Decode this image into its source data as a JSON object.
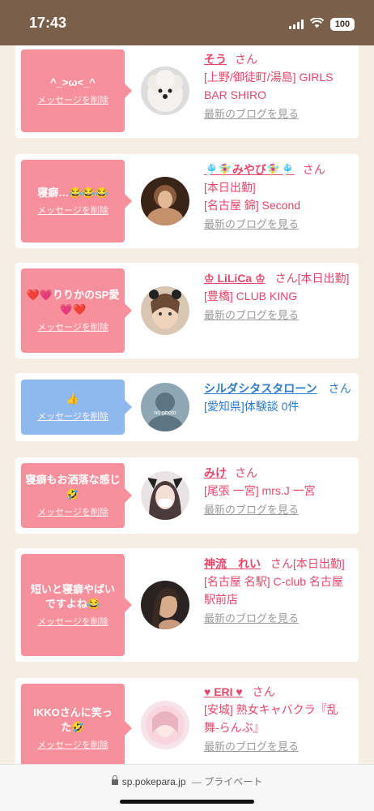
{
  "status": {
    "time": "17:43",
    "battery": "100"
  },
  "colors": {
    "status_bar": "#7a5f4a",
    "page_bg": "#f7eee3",
    "pink_bubble": "#f7909c",
    "blue_bubble": "#8db9ee",
    "name_pink": "#e5486a",
    "name_blue": "#2e7bc9",
    "blog_link": "#9a9a9a"
  },
  "common": {
    "delete_label": "メッセージを削除",
    "honorific": "さん",
    "blog_label": "最新のブログを見る"
  },
  "cards": [
    {
      "message": "^_>ω<_^",
      "name": "そう",
      "line1": "[上野/御徒町/湯島] GIRLS BAR SHIRO",
      "line2": "",
      "avatar_icon": "poodle-photo"
    },
    {
      "message": "寝癖…😂😂😂",
      "name": "🎐🧚‍♀️みやび🧚‍♀️🎐",
      "line1": "[本日出勤]",
      "line2": "[名古屋 錦] Second",
      "avatar_icon": "woman-photo"
    },
    {
      "message": "❤️💗りりかのSP愛💗❤️",
      "name": "♔ LiLiCa ♔",
      "line1": "[本日出勤]",
      "line2": "[豊橋] CLUB KING",
      "avatar_icon": "woman-photo"
    },
    {
      "message": "👍",
      "name": "シルダシタスタローン",
      "line1": "[愛知県]体験談 0件",
      "line2": "",
      "avatar_icon": "no-photo",
      "avatar_text": "no photo"
    },
    {
      "message": "寝癖もお洒落な感じ🤣",
      "name": "みけ",
      "line1": "[尾張 一宮] mrs.J 一宮",
      "line2": "",
      "avatar_icon": "woman-photo"
    },
    {
      "message": "短いと寝癖やばいですよね😂",
      "name": "神流　れい",
      "line1": "[本日出勤]",
      "line2": "[名古屋 名駅] C-club 名古屋駅前店",
      "avatar_icon": "woman-photo"
    },
    {
      "message": "IKKOさんに笑った🤣",
      "name": "♥ ERI ♥",
      "line1": "[安城] 熟女キャバクラ『乱舞-らんぶ』",
      "line2": "",
      "avatar_icon": "woman-photo"
    }
  ],
  "browser": {
    "domain": "sp.pokepara.jp",
    "mode": "— プライベート"
  }
}
